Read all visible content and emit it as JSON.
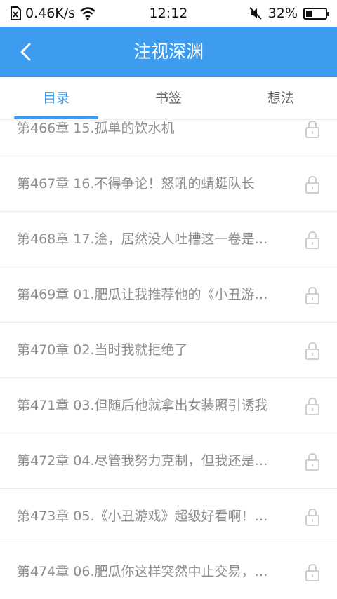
{
  "status_bar": {
    "network_speed": "0.46K/s",
    "time": "12:12",
    "battery_percent": "32%",
    "battery_level": 0.32
  },
  "app_bar": {
    "title": "注视深渊",
    "back_icon": "chevron-left-icon",
    "color": "#3d9cf0"
  },
  "tabs": [
    {
      "label": "目录",
      "active": true
    },
    {
      "label": "书签",
      "active": false
    },
    {
      "label": "想法",
      "active": false
    }
  ],
  "chapters": [
    {
      "label": "第466章 15.孤单的饮水机",
      "locked": true
    },
    {
      "label": "第467章 16.不得争论！怒吼的蜻蜓队长",
      "locked": true
    },
    {
      "label": "第468章 17.淦，居然没人吐槽这一卷是…",
      "locked": true
    },
    {
      "label": "第469章 01.肥瓜让我推荐他的《小丑游…",
      "locked": true
    },
    {
      "label": "第470章 02.当时我就拒绝了",
      "locked": true
    },
    {
      "label": "第471章 03.但随后他就拿出女装照引诱我",
      "locked": true
    },
    {
      "label": "第472章 04.尽管我努力克制，但我还是…",
      "locked": true
    },
    {
      "label": "第473章 05.《小丑游戏》超级好看啊！…",
      "locked": true
    },
    {
      "label": "第474章 06.肥瓜你这样突然中止交易，…",
      "locked": true
    }
  ]
}
